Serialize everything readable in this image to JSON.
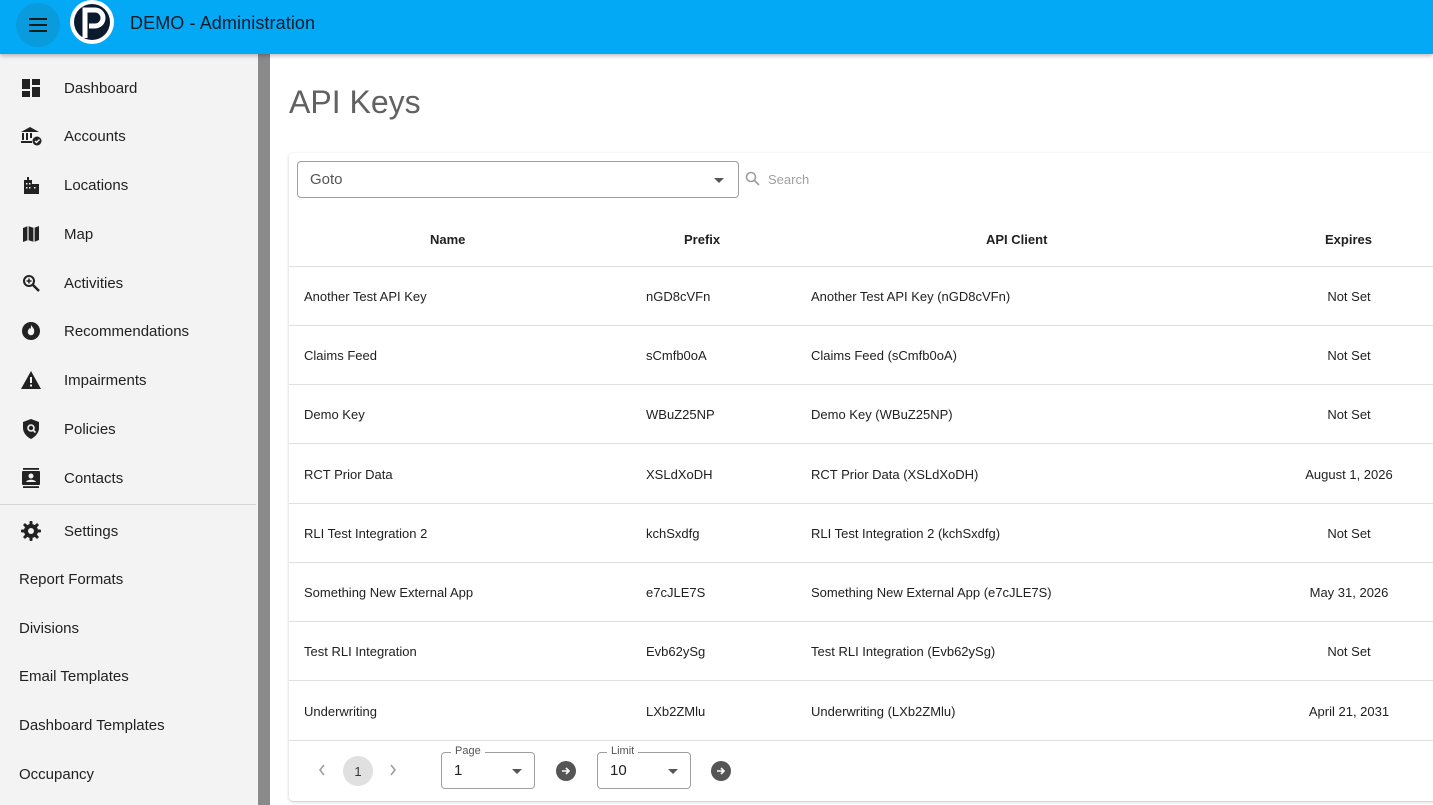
{
  "app": {
    "title": "DEMO - Administration"
  },
  "sidebar": {
    "items": [
      {
        "label": "Dashboard",
        "icon": "dashboard-icon"
      },
      {
        "label": "Accounts",
        "icon": "bank-check-icon"
      },
      {
        "label": "Locations",
        "icon": "buildings-icon"
      },
      {
        "label": "Map",
        "icon": "map-icon"
      },
      {
        "label": "Activities",
        "icon": "zoom-in-icon"
      },
      {
        "label": "Recommendations",
        "icon": "flame-badge-icon"
      },
      {
        "label": "Impairments",
        "icon": "warning-icon"
      },
      {
        "label": "Policies",
        "icon": "shield-search-icon"
      },
      {
        "label": "Contacts",
        "icon": "contacts-icon"
      },
      {
        "label": "Settings",
        "icon": "gear-icon"
      }
    ],
    "plain_items": [
      "Report Formats",
      "Divisions",
      "Email Templates",
      "Dashboard Templates",
      "Occupancy"
    ]
  },
  "main": {
    "title": "API Keys",
    "goto": {
      "value": "Goto"
    },
    "search": {
      "placeholder": "Search"
    },
    "table": {
      "columns": [
        "Name",
        "Prefix",
        "API Client",
        "Expires"
      ],
      "rows": [
        [
          "Another Test API Key",
          "nGD8cVFn",
          "Another Test API Key (nGD8cVFn)",
          "Not Set"
        ],
        [
          "Claims Feed",
          "sCmfb0oA",
          "Claims Feed (sCmfb0oA)",
          "Not Set"
        ],
        [
          "Demo Key",
          "WBuZ25NP",
          "Demo Key (WBuZ25NP)",
          "Not Set"
        ],
        [
          "RCT Prior Data",
          "XSLdXoDH",
          "RCT Prior Data (XSLdXoDH)",
          "August 1, 2026"
        ],
        [
          "RLI Test Integration 2",
          "kchSxdfg",
          "RLI Test Integration 2 (kchSxdfg)",
          "Not Set"
        ],
        [
          "Something New External App",
          "e7cJLE7S",
          "Something New External App (e7cJLE7S)",
          "May 31, 2026"
        ],
        [
          "Test RLI Integration",
          "Evb62ySg",
          "Test RLI Integration (Evb62ySg)",
          "Not Set"
        ],
        [
          "Underwriting",
          "LXb2ZMlu",
          "Underwriting (LXb2ZMlu)",
          "April 21, 2031"
        ]
      ]
    },
    "pagination": {
      "current_page": "1",
      "page_label": "Page",
      "page_value": "1",
      "limit_label": "Limit",
      "limit_value": "10"
    }
  },
  "colors": {
    "appbar": "#03a9f4",
    "sidebar": "#f3f3f3"
  }
}
